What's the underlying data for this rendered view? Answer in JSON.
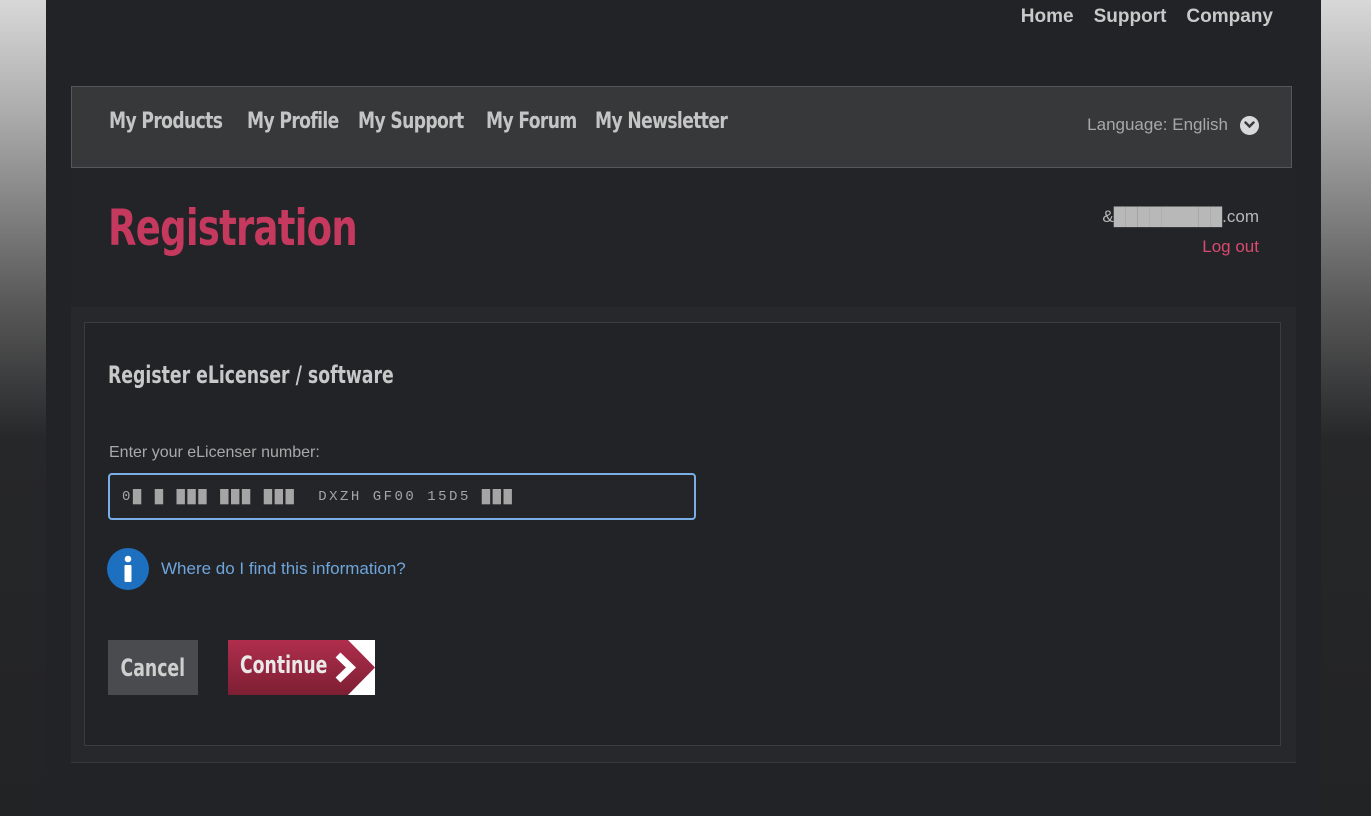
{
  "topnav": {
    "home": "Home",
    "support": "Support",
    "company": "Company"
  },
  "mainnav": {
    "items": [
      "My Products",
      "My Profile",
      "My Support",
      "My Forum",
      "My Newsletter"
    ],
    "language_label": "Language: English"
  },
  "header": {
    "title": "Registration",
    "user_email": "&█████████.com",
    "logout": "Log out"
  },
  "form": {
    "title": "Register eLicenser / software",
    "field_label": "Enter your eLicenser number:",
    "license_value": "0█ █ ███ ███ ███  DXZH GF00 15D5 ███",
    "help_link": "Where do I find this information?",
    "cancel_label": "Cancel",
    "continue_label": "Continue"
  },
  "colors": {
    "accent": "#c5395f",
    "link": "#6ea6dc",
    "info": "#1d6fc0"
  }
}
